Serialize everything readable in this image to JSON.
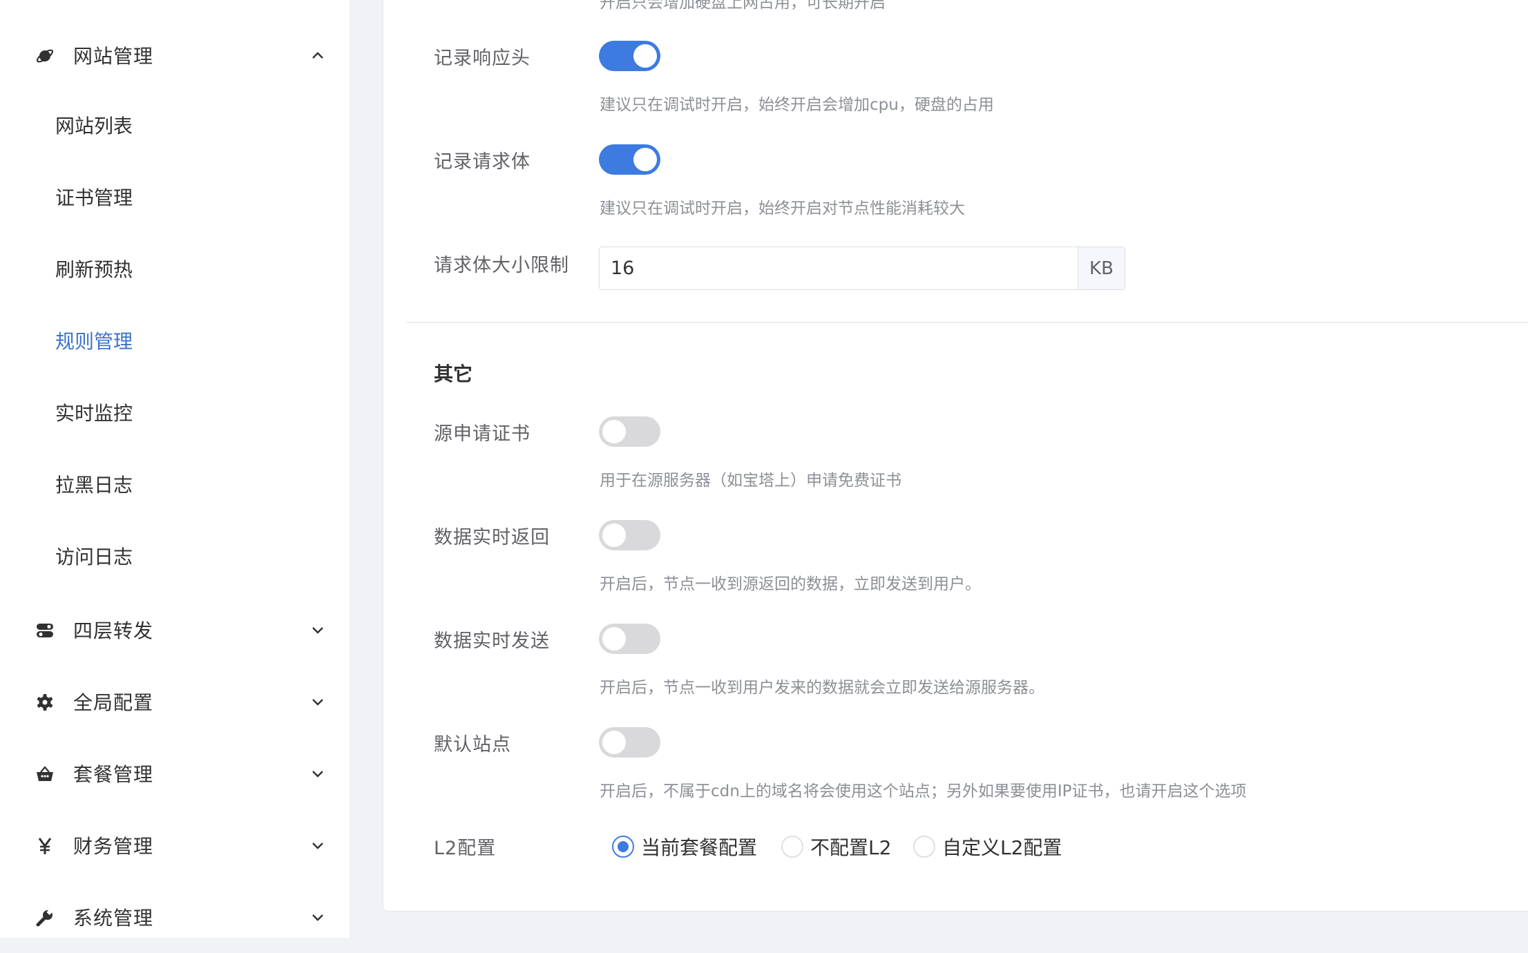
{
  "sidebar": {
    "groups": {
      "website": {
        "label": "网站管理",
        "icon": "planet-icon",
        "expanded": true
      },
      "l4": {
        "label": "四层转发",
        "icon": "toggle-icon"
      },
      "global": {
        "label": "全局配置",
        "icon": "gear-icon"
      },
      "package": {
        "label": "套餐管理",
        "icon": "basket-icon"
      },
      "finance": {
        "label": "财务管理",
        "icon": "yen-icon"
      },
      "system": {
        "label": "系统管理",
        "icon": "wrench-icon"
      }
    },
    "website_items": [
      "网站列表",
      "证书管理",
      "刷新预热",
      "规则管理",
      "实时监控",
      "拉黑日志",
      "访问日志"
    ],
    "active_item": "规则管理"
  },
  "form": {
    "top_cut_hint": "开启只会增加硬盘上网占用，可长期开启",
    "log_resp_header": {
      "label": "记录响应头",
      "on": true,
      "hint": "建议只在调试时开启，始终开启会增加cpu，硬盘的占用"
    },
    "log_req_body": {
      "label": "记录请求体",
      "on": true,
      "hint": "建议只在调试时开启，始终开启对节点性能消耗较大"
    },
    "req_body_limit": {
      "label": "请求体大小限制",
      "value": "16",
      "unit": "KB"
    },
    "other_section": "其它",
    "origin_cert": {
      "label": "源申请证书",
      "on": false,
      "hint": "用于在源服务器（如宝塔上）申请免费证书"
    },
    "realtime_return": {
      "label": "数据实时返回",
      "on": false,
      "hint": "开启后，节点一收到源返回的数据，立即发送到用户。"
    },
    "realtime_send": {
      "label": "数据实时发送",
      "on": false,
      "hint": "开启后，节点一收到用户发来的数据就会立即发送给源服务器。"
    },
    "default_site": {
      "label": "默认站点",
      "on": false,
      "hint": "开启后，不属于cdn上的域名将会使用这个站点；另外如果要使用IP证书，也请开启这个选项"
    },
    "l2": {
      "label": "L2配置",
      "options": [
        "当前套餐配置",
        "不配置L2",
        "自定义L2配置"
      ],
      "selected": "当前套餐配置"
    }
  },
  "colors": {
    "accent": "#3d7be0",
    "active_menu": "#3a73c8",
    "toggle_off": "#d9d9db"
  }
}
